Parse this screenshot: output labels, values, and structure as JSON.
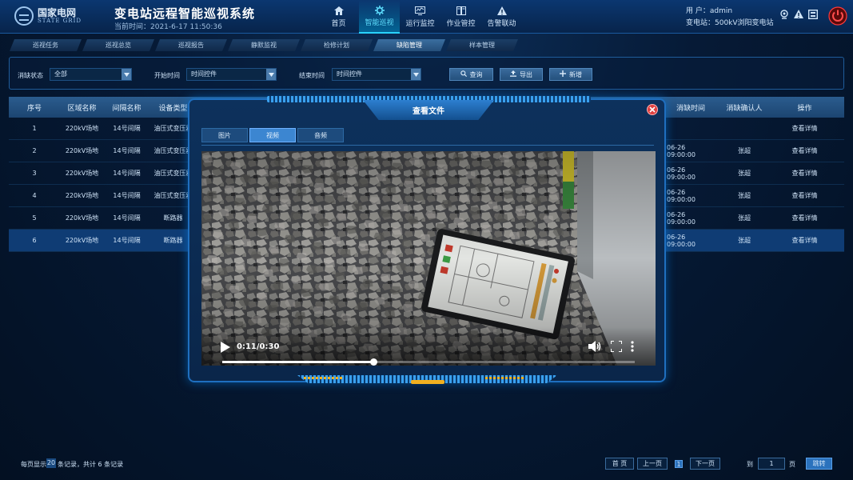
{
  "header": {
    "logo_cn": "国家电网",
    "logo_en": "STATE GRID",
    "title": "变电站远程智能巡视系统",
    "datetime": "当前时间：2021-6-17  11:50:36",
    "user_label": "用    户：admin",
    "station_label": "变电站：500kV浏阳变电站"
  },
  "nav": [
    {
      "label": "首页",
      "icon": "home-icon"
    },
    {
      "label": "智能巡视",
      "icon": "gear-icon",
      "active": true
    },
    {
      "label": "运行监控",
      "icon": "monitor-icon"
    },
    {
      "label": "作业管控",
      "icon": "book-icon"
    },
    {
      "label": "告警联动",
      "icon": "warning-icon"
    }
  ],
  "tabs": [
    "巡视任务",
    "巡视总览",
    "巡视报告",
    "静默监视",
    "检修计划",
    "缺陷管理",
    "样本管理"
  ],
  "active_tab": "缺陷管理",
  "filter": {
    "status_label": "消缺状态",
    "status_value": "全部",
    "start_label": "开始时间",
    "start_value": "时间控件",
    "end_label": "结束时间",
    "end_value": "时间控件",
    "query": "查询",
    "export": "导出",
    "add": "新增"
  },
  "table": {
    "headers": [
      "序号",
      "区域名称",
      "间隔名称",
      "设备类型",
      "消缺时间",
      "消缺确认人",
      "操作"
    ],
    "rows": [
      [
        "1",
        "220kV场地",
        "14号间隔",
        "油压式变压器",
        "",
        "",
        "查看详情"
      ],
      [
        "2",
        "220kV场地",
        "14号间隔",
        "油压式变压器",
        "06-26 09:00:00",
        "张超",
        "查看详情"
      ],
      [
        "3",
        "220kV场地",
        "14号间隔",
        "油压式变压器",
        "06-26 09:00:00",
        "张超",
        "查看详情"
      ],
      [
        "4",
        "220kV场地",
        "14号间隔",
        "油压式变压器",
        "06-26 09:00:00",
        "张超",
        "查看详情"
      ],
      [
        "5",
        "220kV场地",
        "14号间隔",
        "断路器",
        "06-26 09:00:00",
        "张超",
        "查看详情"
      ],
      [
        "6",
        "220kV场地",
        "14号间隔",
        "断路器",
        "06-26 09:00:00",
        "张超",
        "查看详情"
      ]
    ]
  },
  "pager": {
    "prefix": "每页显示",
    "page_size": "20",
    "suffix": "条记录，共计 6 条记录",
    "first": "首 页",
    "prev": "上一页",
    "current": "1",
    "next": "下一页",
    "goto_label": "到",
    "goto_value": "1",
    "page_unit": "页",
    "jump": "跳转"
  },
  "modal": {
    "title": "查看文件",
    "tabs": [
      "图片",
      "视频",
      "音频"
    ],
    "active_tab": "视频",
    "video": {
      "time": "0:11/0:30",
      "progress": 0.367
    }
  },
  "colors": {
    "accent": "#2ad2ff",
    "header_bg": "#0b3770",
    "close_red": "#e04040"
  }
}
